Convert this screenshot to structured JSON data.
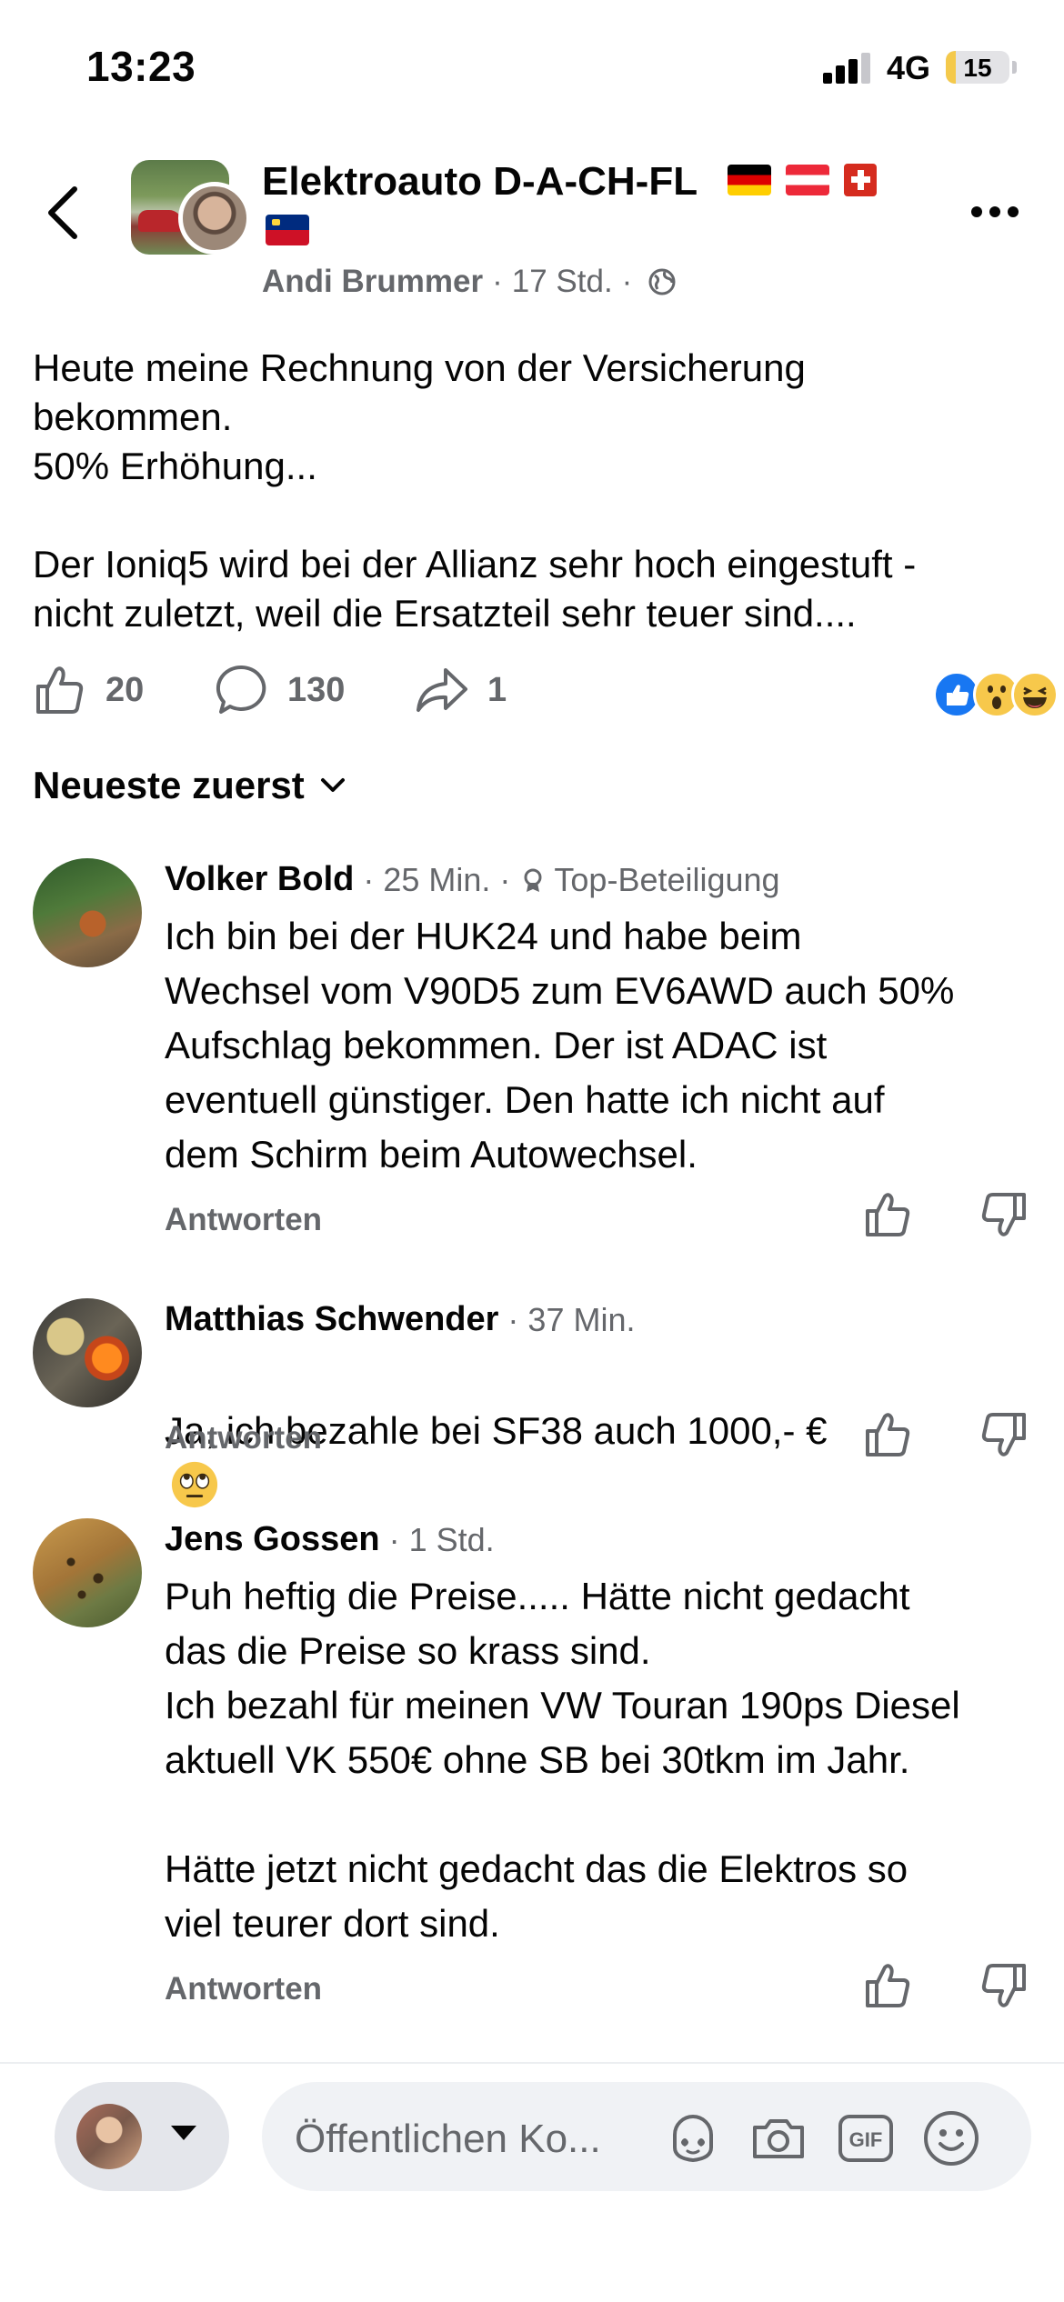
{
  "status_bar": {
    "time": "13:23",
    "network": "4G",
    "battery": "15",
    "battery_level": 0.15
  },
  "post": {
    "group_name": "Elektroauto D-A-CH-FL",
    "author": "Andi Brummer",
    "time": "17 Std.",
    "paragraph1": "Heute meine Rechnung von der Versicherung\nbekommen.\n50% Erhöhung...",
    "paragraph2": "Der Ioniq5 wird bei der Allianz sehr hoch eingestuft -\nnicht zuletzt, weil die Ersatzteil sehr teuer sind....",
    "likes": "20",
    "comments": "130",
    "shares": "1"
  },
  "sort": {
    "label": "Neueste zuerst"
  },
  "comments": [
    {
      "name": "Volker Bold",
      "time": "25 Min.",
      "badge": "Top-Beteiligung",
      "text": "Ich bin bei der HUK24 und habe beim\nWechsel vom V90D5 zum EV6AWD auch 50%\nAufschlag bekommen. Der ist ADAC ist\neventuell günstiger. Den hatte ich nicht auf\ndem Schirm beim Autowechsel.",
      "reply": "Antworten"
    },
    {
      "name": "Matthias Schwender",
      "time": "37 Min.",
      "text": "Ja, ich bezahle bei SF38 auch 1000,- €",
      "reply": "Antworten"
    },
    {
      "name": "Jens Gossen",
      "time": "1 Std.",
      "text": "Puh heftig die Preise..... Hätte nicht gedacht\ndas die Preise so krass sind.\nIch bezahl für meinen VW Touran 190ps Diesel\naktuell VK 550€ ohne SB bei 30tkm im Jahr.\n\nHätte jetzt nicht gedacht das die Elektros so\nviel teurer dort sind.",
      "reply": "Antworten"
    }
  ],
  "composer": {
    "placeholder": "Öffentlichen Ko...",
    "gif_label": "GIF"
  },
  "icons": [
    "back-icon",
    "more-icon",
    "globe-icon",
    "like-icon",
    "comment-icon",
    "share-icon",
    "chevron-down-icon",
    "badge-icon",
    "thumbs-up-icon",
    "thumbs-down-icon",
    "avatar-sticker-icon",
    "camera-icon",
    "gif-icon",
    "emoji-icon"
  ],
  "colors": {
    "text": "#050505",
    "secondary": "#65676b",
    "like_blue": "#1877f2",
    "input_bg": "#f0f2f5"
  }
}
